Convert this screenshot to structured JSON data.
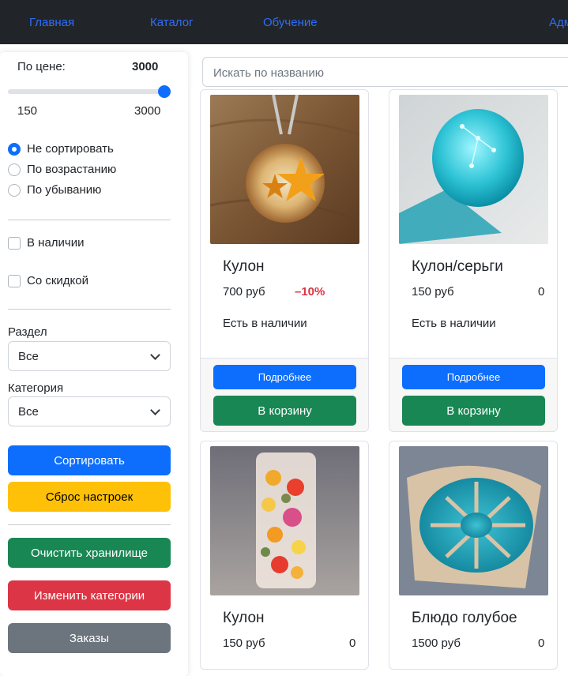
{
  "navbar": {
    "links": [
      "Главная",
      "Каталог",
      "Обучение",
      "Адм"
    ]
  },
  "filters": {
    "price_label": "По цене:",
    "price_value": "3000",
    "range_min": "150",
    "range_max": "3000",
    "range_level": 1.0,
    "sort_options": [
      "Не сортировать",
      "По возрастанию",
      "По убыванию"
    ],
    "sort_selected": "Не сортировать",
    "in_stock_label": "В наличии",
    "discount_label": "Со скидкой",
    "section_label": "Раздел",
    "section_value": "Все",
    "category_label": "Категория",
    "category_value": "Все",
    "sort_button": "Сортировать",
    "reset_button": "Сброс настроек",
    "clear_storage_button": "Очистить хранилище",
    "edit_categories_button": "Изменить категории",
    "orders_button": "Заказы"
  },
  "search": {
    "placeholder": "Искать по названию"
  },
  "products": [
    {
      "title": "Кулон",
      "price": "700 руб",
      "discount": "–10%",
      "stock": "Есть в наличии",
      "details": "Подробнее",
      "cart": "В корзину"
    },
    {
      "title": "Кулон/серьги",
      "price": "150 руб",
      "discount": "0",
      "stock": "Есть в наличии",
      "details": "Подробнее",
      "cart": "В корзину"
    },
    {
      "title": "Кулон",
      "price": "150 руб",
      "discount": "0"
    },
    {
      "title": "Блюдо голубое",
      "price": "1500 руб",
      "discount": "0"
    }
  ],
  "colors": {
    "navbar_bg": "#212529",
    "nav_link": "#2f6df6",
    "primary": "#0d6efd",
    "success": "#198754",
    "warning": "#ffc107",
    "danger": "#dc3545",
    "secondary": "#6c757d"
  }
}
